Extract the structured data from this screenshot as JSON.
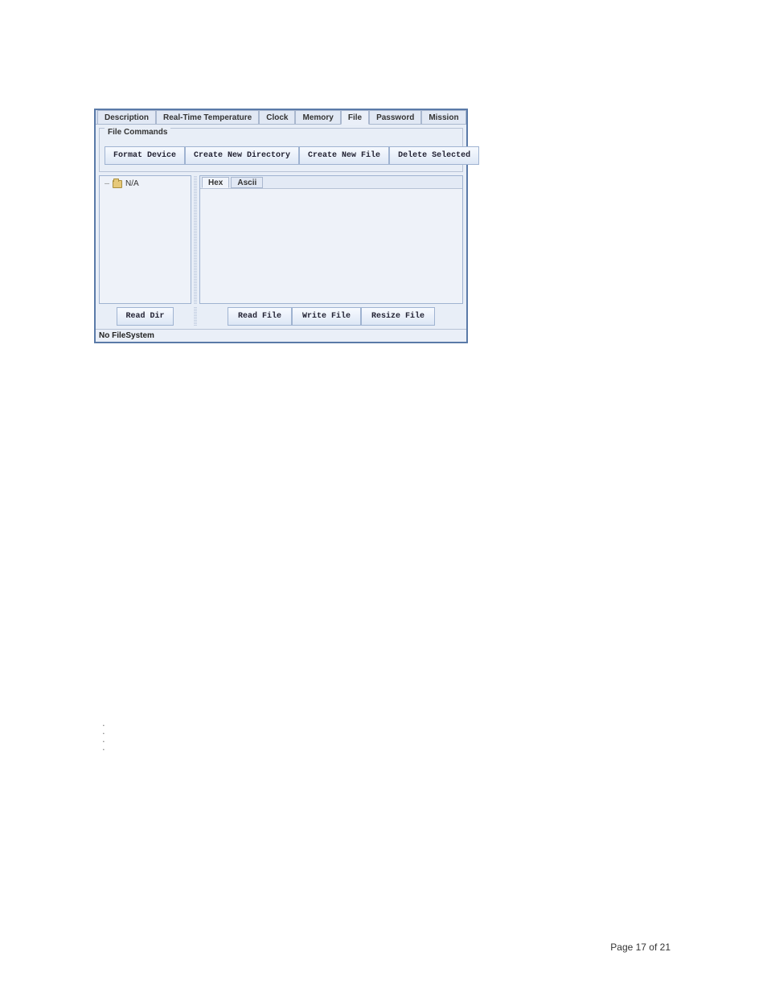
{
  "tabs": {
    "description": "Description",
    "realtime_temp": "Real-Time Temperature",
    "clock": "Clock",
    "memory": "Memory",
    "file": "File",
    "password": "Password",
    "mission": "Mission",
    "active": "File"
  },
  "file_commands": {
    "legend": "File Commands",
    "format_device": "Format Device",
    "create_new_directory": "Create New Directory",
    "create_new_file": "Create New File",
    "delete_selected": "Delete Selected"
  },
  "tree": {
    "root_label": "N/A"
  },
  "hex_tabs": {
    "hex": "Hex",
    "ascii": "Ascii",
    "active": "Hex"
  },
  "bottom_buttons": {
    "read_dir": "Read Dir",
    "read_file": "Read File",
    "write_file": "Write File",
    "resize_file": "Resize File"
  },
  "status": "No FileSystem",
  "footer": "Page 17 of 21"
}
